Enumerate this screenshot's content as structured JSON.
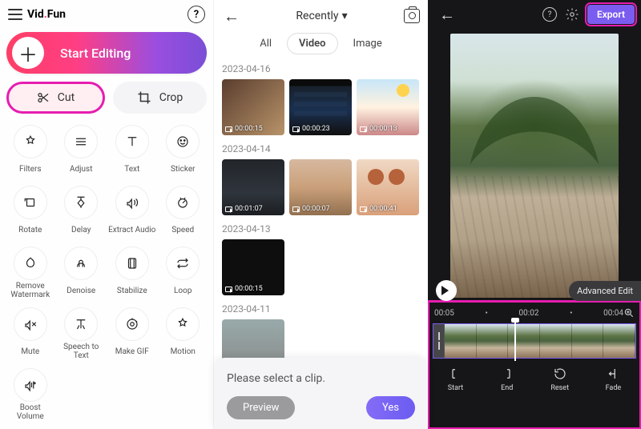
{
  "left": {
    "brand_a": "Vid",
    "brand_b": "Fun",
    "start_label": "Start Editing",
    "cut_label": "Cut",
    "crop_label": "Crop",
    "tools": [
      {
        "label": "Filters",
        "icon": "filters"
      },
      {
        "label": "Adjust",
        "icon": "adjust"
      },
      {
        "label": "Text",
        "icon": "text"
      },
      {
        "label": "Sticker",
        "icon": "sticker"
      },
      {
        "label": "Rotate",
        "icon": "rotate"
      },
      {
        "label": "Delay",
        "icon": "delay"
      },
      {
        "label": "Extract Audio",
        "icon": "extract-audio"
      },
      {
        "label": "Speed",
        "icon": "speed"
      },
      {
        "label": "Remove Watermark",
        "icon": "remove-watermark"
      },
      {
        "label": "Denoise",
        "icon": "denoise"
      },
      {
        "label": "Stabilize",
        "icon": "stabilize"
      },
      {
        "label": "Loop",
        "icon": "loop"
      },
      {
        "label": "Mute",
        "icon": "mute"
      },
      {
        "label": "Speech to Text",
        "icon": "speech-to-text"
      },
      {
        "label": "Make GIF",
        "icon": "make-gif"
      },
      {
        "label": "Motion",
        "icon": "motion"
      },
      {
        "label": "Boost Volume",
        "icon": "boost-volume"
      }
    ]
  },
  "mid": {
    "sort_label": "Recently",
    "tabs": {
      "all": "All",
      "video": "Video",
      "image": "Image"
    },
    "groups": [
      {
        "date": "2023-04-16",
        "clips": [
          {
            "d": "00:00:15"
          },
          {
            "d": "00:00:23"
          },
          {
            "d": "00:00:13"
          }
        ]
      },
      {
        "date": "2023-04-14",
        "clips": [
          {
            "d": "00:01:07"
          },
          {
            "d": "00:00:07"
          },
          {
            "d": "00:00:41"
          }
        ]
      },
      {
        "date": "2023-04-13",
        "clips": [
          {
            "d": "00:00:15"
          }
        ]
      },
      {
        "date": "2023-04-11",
        "clips": [
          {
            "d": ""
          }
        ]
      }
    ],
    "sheet": {
      "msg": "Please select a clip.",
      "preview": "Preview",
      "yes": "Yes"
    }
  },
  "right": {
    "export": "Export",
    "advanced": "Advanced Edit",
    "time_a": "00:05",
    "time_b": "00:02",
    "time_c": "00:04",
    "btns": {
      "start": "Start",
      "end": "End",
      "reset": "Reset",
      "fade": "Fade"
    }
  }
}
